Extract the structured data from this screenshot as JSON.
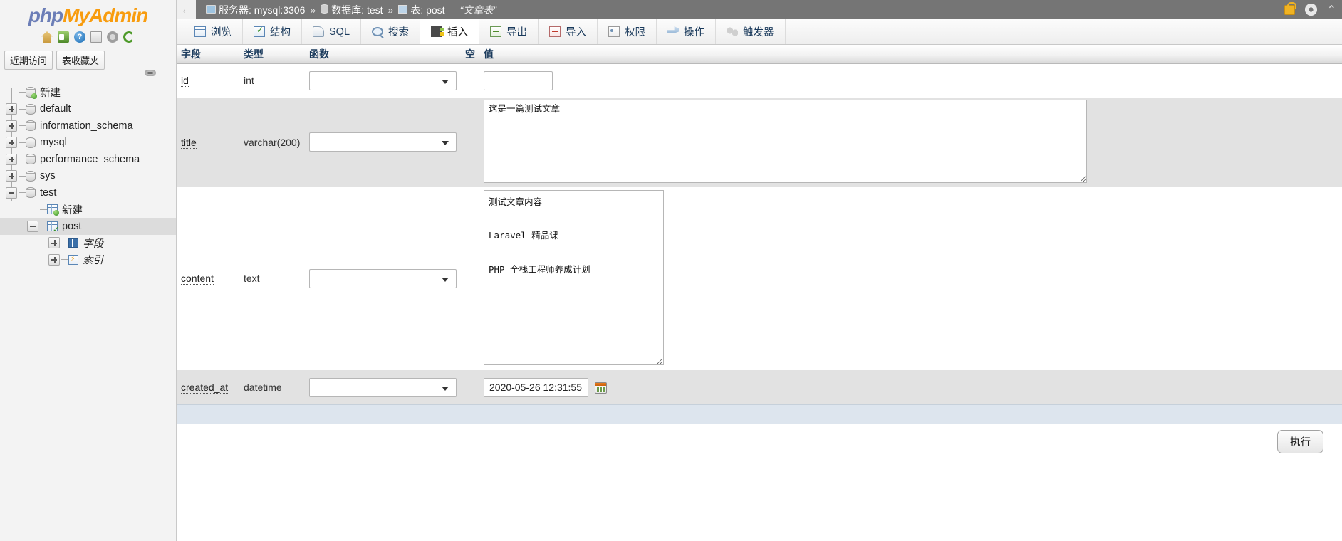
{
  "brand": {
    "php": "php",
    "my": "My",
    "admin": "Admin"
  },
  "sidebar": {
    "icons": [
      {
        "name": "home-icon",
        "label": "主页"
      },
      {
        "name": "logout-icon",
        "label": "退出"
      },
      {
        "name": "help-icon",
        "label": "?"
      },
      {
        "name": "doc-icon",
        "label": "文档"
      },
      {
        "name": "settings-gear-icon",
        "label": "设置"
      },
      {
        "name": "refresh-icon",
        "label": "刷新"
      }
    ],
    "tabs": [
      {
        "label": "近期访问"
      },
      {
        "label": "表收藏夹"
      }
    ],
    "tree": [
      {
        "label": "新建",
        "level": 0,
        "toggle": "none",
        "icon": "new-database-icon",
        "selected": false,
        "italic": false
      },
      {
        "label": "default",
        "level": 0,
        "toggle": "plus",
        "icon": "database-icon",
        "selected": false,
        "italic": false
      },
      {
        "label": "information_schema",
        "level": 0,
        "toggle": "plus",
        "icon": "database-icon",
        "selected": false,
        "italic": false
      },
      {
        "label": "mysql",
        "level": 0,
        "toggle": "plus",
        "icon": "database-icon",
        "selected": false,
        "italic": false
      },
      {
        "label": "performance_schema",
        "level": 0,
        "toggle": "plus",
        "icon": "database-icon",
        "selected": false,
        "italic": false
      },
      {
        "label": "sys",
        "level": 0,
        "toggle": "plus",
        "icon": "database-icon",
        "selected": false,
        "italic": false
      },
      {
        "label": "test",
        "level": 0,
        "toggle": "minus",
        "icon": "database-icon",
        "selected": false,
        "italic": false
      },
      {
        "label": "新建",
        "level": 1,
        "toggle": "none",
        "icon": "new-table-icon",
        "selected": false,
        "italic": false
      },
      {
        "label": "post",
        "level": 1,
        "toggle": "minus",
        "icon": "table-icon",
        "selected": true,
        "italic": false
      },
      {
        "label": "字段",
        "level": 2,
        "toggle": "plus",
        "icon": "columns-icon",
        "selected": false,
        "italic": true
      },
      {
        "label": "索引",
        "level": 2,
        "toggle": "plus",
        "icon": "index-icon",
        "selected": false,
        "italic": true
      }
    ]
  },
  "topbar": {
    "back_label": "←",
    "breadcrumb": [
      {
        "icon": "server-icon",
        "label": "服务器: mysql:3306"
      },
      {
        "icon": "database-icon",
        "label": "数据库: test"
      },
      {
        "icon": "table-icon",
        "label": "表: post"
      }
    ],
    "separator": "»",
    "table_comment": "“文章表”",
    "right_icons": [
      {
        "name": "lock-icon"
      },
      {
        "name": "gear-icon"
      },
      {
        "name": "collapse-chevron-icon",
        "glyph": "⌃"
      }
    ]
  },
  "tabs": [
    {
      "label": "浏览",
      "icon": "browse-icon",
      "active": false
    },
    {
      "label": "结构",
      "icon": "structure-icon",
      "active": false
    },
    {
      "label": "SQL",
      "icon": "sql-icon",
      "active": false
    },
    {
      "label": "搜索",
      "icon": "search-icon",
      "active": false
    },
    {
      "label": "插入",
      "icon": "insert-icon",
      "active": true
    },
    {
      "label": "导出",
      "icon": "export-icon",
      "active": false
    },
    {
      "label": "导入",
      "icon": "import-icon",
      "active": false
    },
    {
      "label": "权限",
      "icon": "privileges-icon",
      "active": false
    },
    {
      "label": "操作",
      "icon": "operations-icon",
      "active": false
    },
    {
      "label": "触发器",
      "icon": "triggers-icon",
      "active": false
    }
  ],
  "insert_form": {
    "headers": {
      "field": "字段",
      "type": "类型",
      "function": "函数",
      "null": "空",
      "value": "值"
    },
    "function_options": [
      ""
    ],
    "rows": [
      {
        "field": "id",
        "type": "int",
        "function": "",
        "null": "",
        "value": "",
        "control": "text",
        "width_class": "w-id"
      },
      {
        "field": "title",
        "type": "varchar(200)",
        "function": "",
        "null": "",
        "value": "这是一篇测试文章",
        "control": "textarea",
        "width_class": "t-title"
      },
      {
        "field": "content",
        "type": "text",
        "function": "",
        "null": "",
        "value": "测试文章内容\n\nLaravel 精品课\n\nPHP 全栈工程师养成计划",
        "control": "textarea",
        "width_class": "t-content"
      },
      {
        "field": "created_at",
        "type": "datetime",
        "function": "",
        "null": "",
        "value": "2020-05-26 12:31:55",
        "control": "datetime",
        "width_class": "w-date"
      }
    ],
    "calendar_icon": "calendar-icon",
    "submit_label": "执行"
  },
  "colors": {
    "brand_blue": "#6c7eb7",
    "brand_orange": "#f89c0e",
    "topbar_gray": "#757575",
    "selection_gray": "#dcdcdc",
    "row_alt_gray": "#e2e2e2",
    "footer_band": "#dde5ee"
  }
}
